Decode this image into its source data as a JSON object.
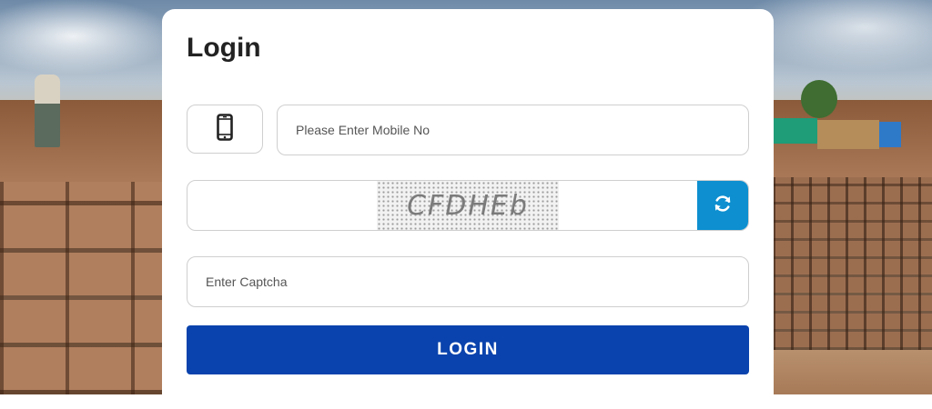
{
  "login": {
    "title": "Login",
    "mobile_icon": "mobile-phone-icon",
    "mobile_placeholder": "Please Enter Mobile No",
    "captcha_text": "CFDHEb",
    "refresh_icon": "refresh-icon",
    "captcha_placeholder": "Enter Captcha",
    "submit_label": "LOGIN"
  },
  "colors": {
    "primary_button": "#0a43ad",
    "refresh_button": "#0d8fd0",
    "card": "#ffffff"
  }
}
